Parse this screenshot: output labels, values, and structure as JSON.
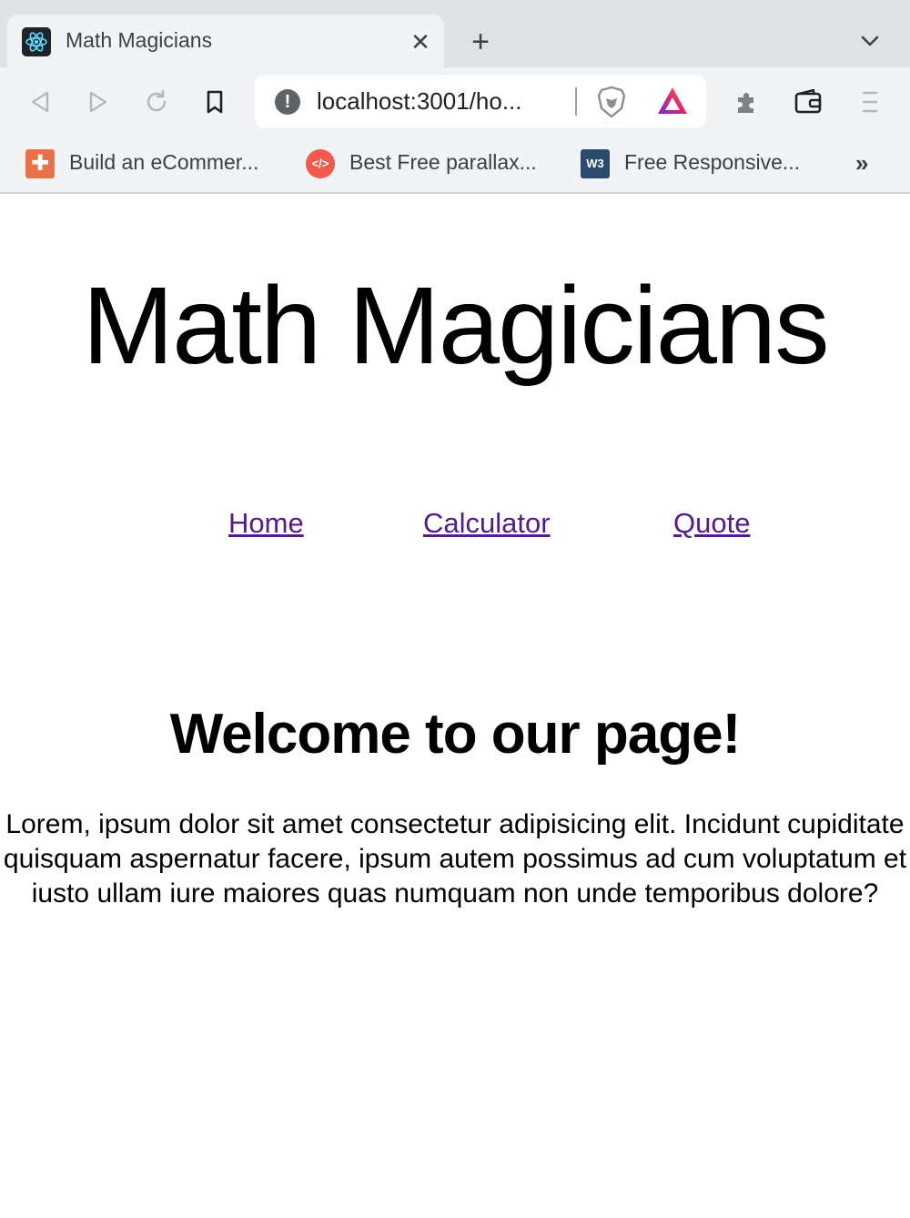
{
  "browser": {
    "tab": {
      "title": "Math Magicians",
      "favicon": "react-logo-icon",
      "close_glyph": "✕"
    },
    "new_tab_glyph": "+",
    "address_bar": {
      "url": "localhost:3001/ho...",
      "security_icon": "info-icon",
      "info_glyph": "!"
    },
    "bookmarks": [
      {
        "label": "Build an eCommer...",
        "icon": "plus-square-icon",
        "glyph": "✚",
        "color": "#e8714a"
      },
      {
        "label": "Best Free parallax...",
        "icon": "code-icon",
        "glyph": "</>",
        "color": "#ef5a4c"
      },
      {
        "label": "Free Responsive...",
        "icon": "w3-icon",
        "glyph": "W3",
        "color": "#2c4a6b"
      }
    ],
    "bookmarks_more": "»"
  },
  "page": {
    "title": "Math Magicians",
    "nav": [
      {
        "label": "Home"
      },
      {
        "label": "Calculator"
      },
      {
        "label": "Quote"
      }
    ],
    "welcome_heading": "Welcome to our page!",
    "paragraph": "Lorem, ipsum dolor sit amet consectetur adipisicing elit. Incidunt cupiditate quisquam aspernatur facere, ipsum autem possimus ad cum voluptatum et iusto ullam iure maiores quas numquam non unde temporibus dolore?"
  },
  "colors": {
    "link": "#551a8b",
    "chrome_bg": "#f1f3f4",
    "tabstrip_bg": "#dfe1e5"
  }
}
